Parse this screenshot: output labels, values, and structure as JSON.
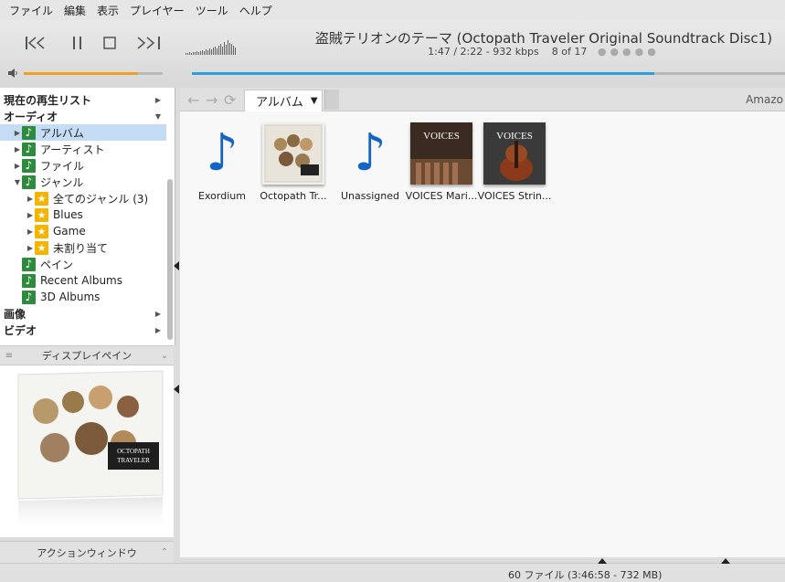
{
  "menu": [
    "ファイル",
    "編集",
    "表示",
    "プレイヤー",
    "ツール",
    "ヘルプ"
  ],
  "now_playing": {
    "title": "盗賊テリオンのテーマ (Octopath Traveler Original Soundtrack Disc1)",
    "time": "1:47 / 2:22",
    "bitrate": "932 kbps",
    "position": "8 of 17",
    "volume_fraction": 0.82,
    "seek_fraction": 0.78
  },
  "tree": {
    "rows": [
      {
        "label": "現在の再生リスト",
        "type": "header"
      },
      {
        "label": "オーディオ",
        "type": "header"
      },
      {
        "label": "アルバム",
        "type": "note",
        "expand": "right",
        "selected": true
      },
      {
        "label": "アーティスト",
        "type": "note",
        "expand": "right"
      },
      {
        "label": "ファイル",
        "type": "note",
        "expand": "right"
      },
      {
        "label": "ジャンル",
        "type": "note",
        "expand": "down"
      },
      {
        "label": "全てのジャンル (3)",
        "type": "star",
        "expand": "right"
      },
      {
        "label": "Blues",
        "type": "star",
        "expand": "right"
      },
      {
        "label": "Game",
        "type": "star",
        "expand": "right"
      },
      {
        "label": "未割り当て",
        "type": "star",
        "expand": "right"
      },
      {
        "label": "ペイン",
        "type": "note"
      },
      {
        "label": "Recent Albums",
        "type": "note"
      },
      {
        "label": "3D Albums",
        "type": "note"
      },
      {
        "label": "画像",
        "type": "header"
      },
      {
        "label": "ビデオ",
        "type": "header"
      }
    ]
  },
  "display_pane": {
    "label": "ディスプレイペイン"
  },
  "action_window": {
    "label": "アクションウィンドウ"
  },
  "toolbar": {
    "view_label": "アルバム",
    "amazon": "Amazo"
  },
  "albums": [
    {
      "caption": "Exordium",
      "art": "note-icon"
    },
    {
      "caption": "Octopath Tr...",
      "art": "cover-octopath"
    },
    {
      "caption": "Unassigned",
      "art": "note-icon"
    },
    {
      "caption": "VOICES Mari...",
      "art": "cover-voices-marimba"
    },
    {
      "caption": "VOICES Strin...",
      "art": "cover-voices-strings"
    }
  ],
  "status": {
    "text": "60 ファイル (3:46:58 - 732 MB)"
  },
  "colors": {
    "accent_volume": "#f0a020",
    "accent_seek": "#2aa0dc",
    "tree_note": "#2e8b3e",
    "tree_star": "#f5b400",
    "selection": "#c5dcf5"
  }
}
